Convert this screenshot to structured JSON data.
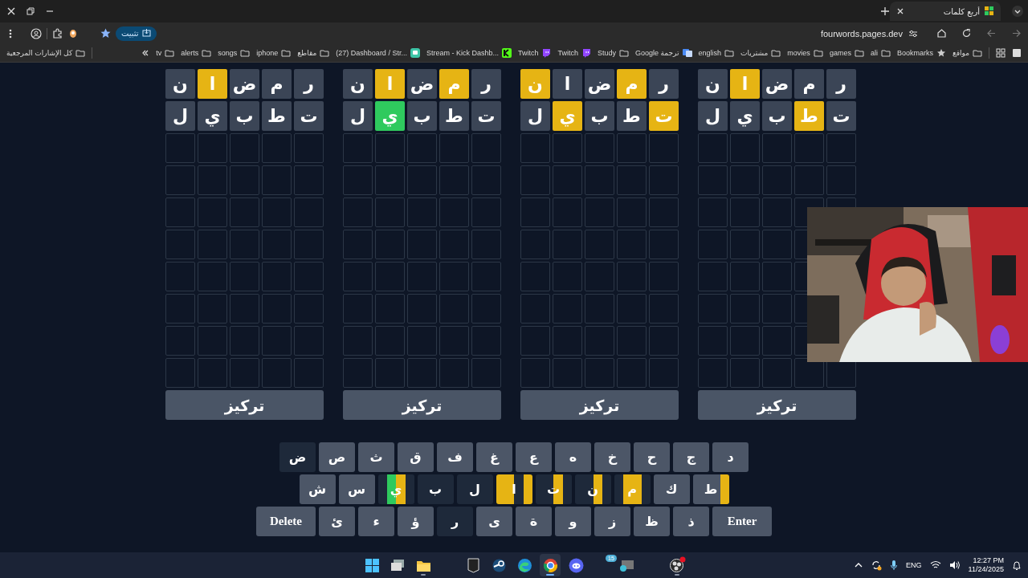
{
  "browser": {
    "tab": {
      "title": "أربع كلمات",
      "selected": true
    },
    "url": "fourwords.pages.dev",
    "install_label": "تثبيت",
    "bookmarks": [
      {
        "kind": "folder",
        "label": "مواقع"
      },
      {
        "kind": "star",
        "label": "Bookmarks"
      },
      {
        "kind": "folder",
        "label": "ali"
      },
      {
        "kind": "folder",
        "label": "games"
      },
      {
        "kind": "folder",
        "label": "movies"
      },
      {
        "kind": "folder",
        "label": "مشتريات"
      },
      {
        "kind": "folder",
        "label": "english"
      },
      {
        "kind": "translate",
        "label": "Google ترجمة"
      },
      {
        "kind": "folder",
        "label": "Study"
      },
      {
        "kind": "twitch",
        "label": "Twitch"
      },
      {
        "kind": "twitch",
        "label": "Twitch"
      },
      {
        "kind": "kick",
        "label": "Stream - Kick Dashb..."
      },
      {
        "kind": "app",
        "label": "(27) Dashboard / Str..."
      },
      {
        "kind": "folder",
        "label": "مقاطع"
      },
      {
        "kind": "folder",
        "label": "iphone"
      },
      {
        "kind": "folder",
        "label": "songs"
      },
      {
        "kind": "folder",
        "label": "alerts"
      },
      {
        "kind": "folder",
        "label": "tv"
      }
    ],
    "all_bookmarks": "كل الإشارات المرجعية"
  },
  "boards": [
    {
      "guesses": [
        [
          {
            "letter": "ر",
            "color": "#3b4556"
          },
          {
            "letter": "م",
            "color": "#3b4556"
          },
          {
            "letter": "ض",
            "color": "#3b4556"
          },
          {
            "letter": "ا",
            "color": "#e6b414"
          },
          {
            "letter": "ن",
            "color": "#3b4556"
          }
        ],
        [
          {
            "letter": "ت",
            "color": "#3b4556"
          },
          {
            "letter": "ط",
            "color": "#e6b414"
          },
          {
            "letter": "ب",
            "color": "#3b4556"
          },
          {
            "letter": "ي",
            "color": "#3b4556"
          },
          {
            "letter": "ل",
            "color": "#3b4556"
          }
        ]
      ],
      "focus_label": "تركيز"
    },
    {
      "guesses": [
        [
          {
            "letter": "ر",
            "color": "#3b4556"
          },
          {
            "letter": "م",
            "color": "#e6b414"
          },
          {
            "letter": "ض",
            "color": "#3b4556"
          },
          {
            "letter": "ا",
            "color": "#3b4556"
          },
          {
            "letter": "ن",
            "color": "#e6b414"
          }
        ],
        [
          {
            "letter": "ت",
            "color": "#e6b414"
          },
          {
            "letter": "ط",
            "color": "#3b4556"
          },
          {
            "letter": "ب",
            "color": "#3b4556"
          },
          {
            "letter": "ي",
            "color": "#e6b414"
          },
          {
            "letter": "ل",
            "color": "#3b4556"
          }
        ]
      ],
      "focus_label": "تركيز"
    },
    {
      "guesses": [
        [
          {
            "letter": "ر",
            "color": "#3b4556"
          },
          {
            "letter": "م",
            "color": "#e6b414"
          },
          {
            "letter": "ض",
            "color": "#3b4556"
          },
          {
            "letter": "ا",
            "color": "#e6b414"
          },
          {
            "letter": "ن",
            "color": "#3b4556"
          }
        ],
        [
          {
            "letter": "ت",
            "color": "#3b4556"
          },
          {
            "letter": "ط",
            "color": "#3b4556"
          },
          {
            "letter": "ب",
            "color": "#3b4556"
          },
          {
            "letter": "ي",
            "color": "#2fca5e"
          },
          {
            "letter": "ل",
            "color": "#3b4556"
          }
        ]
      ],
      "focus_label": "تركيز"
    },
    {
      "guesses": [
        [
          {
            "letter": "ر",
            "color": "#3b4556"
          },
          {
            "letter": "م",
            "color": "#3b4556"
          },
          {
            "letter": "ض",
            "color": "#3b4556"
          },
          {
            "letter": "ا",
            "color": "#e6b414"
          },
          {
            "letter": "ن",
            "color": "#3b4556"
          }
        ],
        [
          {
            "letter": "ت",
            "color": "#3b4556"
          },
          {
            "letter": "ط",
            "color": "#3b4556"
          },
          {
            "letter": "ب",
            "color": "#3b4556"
          },
          {
            "letter": "ي",
            "color": "#3b4556"
          },
          {
            "letter": "ل",
            "color": "#3b4556"
          }
        ]
      ],
      "focus_label": "تركيز"
    }
  ],
  "keyboard": {
    "rows": [
      [
        {
          "kind": "letter",
          "label": "د",
          "color": "#4c5667"
        },
        {
          "kind": "letter",
          "label": "ج",
          "color": "#4c5667"
        },
        {
          "kind": "letter",
          "label": "ح",
          "color": "#4c5667"
        },
        {
          "kind": "letter",
          "label": "خ",
          "color": "#4c5667"
        },
        {
          "kind": "letter",
          "label": "ه",
          "color": "#4c5667"
        },
        {
          "kind": "letter",
          "label": "ع",
          "color": "#4c5667"
        },
        {
          "kind": "letter",
          "label": "غ",
          "color": "#4c5667"
        },
        {
          "kind": "letter",
          "label": "ف",
          "color": "#4c5667"
        },
        {
          "kind": "letter",
          "label": "ق",
          "color": "#4c5667"
        },
        {
          "kind": "letter",
          "label": "ث",
          "color": "#4c5667"
        },
        {
          "kind": "letter",
          "label": "ص",
          "color": "#4c5667"
        },
        {
          "kind": "letter",
          "label": "ض",
          "color": "#1e293a"
        }
      ],
      [
        {
          "kind": "letter",
          "label": "ط",
          "quarters": [
            {
              "color": "#4c5667"
            },
            {
              "color": "#4c5667"
            },
            {
              "color": "#4c5667"
            },
            {
              "color": "#e6b414"
            }
          ]
        },
        {
          "kind": "letter",
          "label": "ك",
          "color": "#4c5667"
        },
        {
          "kind": "letter",
          "label": "م",
          "quarters": [
            {
              "color": "#1e293a"
            },
            {
              "color": "#e6b414"
            },
            {
              "color": "#e6b414"
            },
            {
              "color": "#1e293a"
            }
          ]
        },
        {
          "kind": "letter",
          "label": "ن",
          "quarters": [
            {
              "color": "#1e293a"
            },
            {
              "color": "#1e293a"
            },
            {
              "color": "#e6b414"
            },
            {
              "color": "#1e293a"
            }
          ]
        },
        {
          "kind": "letter",
          "label": "ت",
          "quarters": [
            {
              "color": "#1e293a"
            },
            {
              "color": "#1e293a"
            },
            {
              "color": "#e6b414"
            },
            {
              "color": "#1e293a"
            }
          ]
        },
        {
          "kind": "letter",
          "label": "ا",
          "quarters": [
            {
              "color": "#e6b414"
            },
            {
              "color": "#e6b414"
            },
            {
              "color": "#1e293a"
            },
            {
              "color": "#e6b414"
            }
          ]
        },
        {
          "kind": "letter",
          "label": "ل",
          "color": "#1e293a"
        },
        {
          "kind": "letter",
          "label": "ب",
          "color": "#1e293a"
        },
        {
          "kind": "letter",
          "label": "ي",
          "quarters": [
            {
              "color": "#1e293a"
            },
            {
              "color": "#2fca5e"
            },
            {
              "color": "#e6b414"
            },
            {
              "color": "#1e293a"
            }
          ]
        },
        {
          "kind": "letter",
          "label": "س",
          "color": "#4c5667"
        },
        {
          "kind": "letter",
          "label": "ش",
          "color": "#4c5667"
        }
      ],
      [
        {
          "kind": "action",
          "label": "Enter",
          "color": "#4c5667"
        },
        {
          "kind": "letter",
          "label": "ذ",
          "color": "#4c5667"
        },
        {
          "kind": "letter",
          "label": "ظ",
          "color": "#4c5667"
        },
        {
          "kind": "letter",
          "label": "ز",
          "color": "#4c5667"
        },
        {
          "kind": "letter",
          "label": "و",
          "color": "#4c5667"
        },
        {
          "kind": "letter",
          "label": "ة",
          "color": "#4c5667"
        },
        {
          "kind": "letter",
          "label": "ى",
          "color": "#4c5667"
        },
        {
          "kind": "letter",
          "label": "ر",
          "color": "#1e293a"
        },
        {
          "kind": "letter",
          "label": "ؤ",
          "color": "#4c5667"
        },
        {
          "kind": "letter",
          "label": "ء",
          "color": "#4c5667"
        },
        {
          "kind": "letter",
          "label": "ئ",
          "color": "#4c5667"
        },
        {
          "kind": "action",
          "label": "Delete",
          "color": "#4c5667"
        }
      ]
    ]
  },
  "taskbar": {
    "apps": [
      {
        "kind": "windows",
        "running": false,
        "selected": false
      },
      {
        "kind": "taskview",
        "running": false,
        "selected": false
      },
      {
        "kind": "explorer",
        "running": true,
        "selected": false
      },
      {
        "kind": "epic",
        "running": false,
        "selected": false
      },
      {
        "kind": "steam",
        "running": false,
        "selected": false
      },
      {
        "kind": "edge",
        "running": false,
        "selected": false
      },
      {
        "kind": "chrome",
        "running": true,
        "selected": true
      },
      {
        "kind": "discord",
        "running": false,
        "selected": false
      },
      {
        "kind": "monitor",
        "running": false,
        "selected": false,
        "badge": "15"
      },
      {
        "kind": "obs",
        "running": true,
        "selected": false
      }
    ],
    "language": "ENG",
    "time": "12:27 PM",
    "date": "11/24/2025"
  }
}
